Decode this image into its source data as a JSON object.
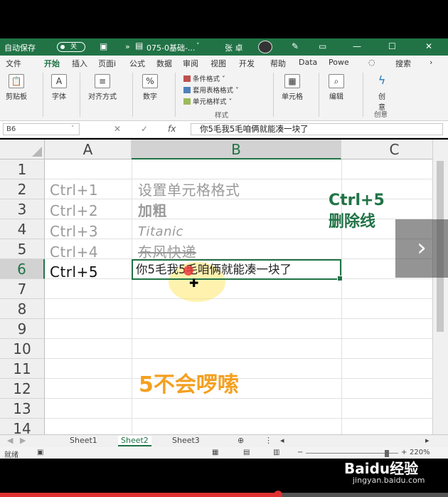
{
  "title_bar": {
    "autosave_label": "自动保存",
    "autosave_state": "关",
    "expand_glyph": "»",
    "file_name": "075-0基础-...",
    "user_name": "张 卓"
  },
  "tabs": [
    "文件",
    "开始",
    "插入",
    "页面⁠i",
    "公式",
    "数据",
    "审阅",
    "视图",
    "开发⁠",
    "帮助",
    "Data",
    "Powe"
  ],
  "active_tab": "开始",
  "search_label": "搜索",
  "ribbon": {
    "clipboard": "剪贴板",
    "font": "字体",
    "align": "对齐方式",
    "number": "数字",
    "cond_format": "条件格式 ˅",
    "table_format": "套用表格格式 ˅",
    "cell_style": "单元格样式 ˅",
    "styles_group": "样式",
    "cells": "单元格",
    "editing": "编辑",
    "create": "创",
    "create2": "意",
    "create_group": "创意"
  },
  "formula_bar": {
    "name_box": "B6",
    "fx": "fx",
    "content": "你5毛我5毛咱俩就能凑一块了"
  },
  "columns": [
    "A",
    "B",
    "C"
  ],
  "rows": [
    "1",
    "2",
    "3",
    "4",
    "5",
    "6",
    "7",
    "8",
    "9",
    "10",
    "11",
    "12",
    "13",
    "14"
  ],
  "cells": {
    "a2": "Ctrl+1",
    "b2": "设置单元格格式",
    "a3": "Ctrl+2",
    "b3": "加粗",
    "a4": "Ctrl+3",
    "b4": "Titanic",
    "a5": "Ctrl+4",
    "b5": "东风快递",
    "a6": "Ctrl+5",
    "b6": "你5毛我5毛咱俩就能凑一块了"
  },
  "annotation": {
    "line1": "Ctrl+5",
    "line2": "删除线",
    "caption": "5不会啰嗦"
  },
  "sheets": [
    "Sheet1",
    "Sheet2",
    "Sheet3"
  ],
  "active_sheet": "Sheet2",
  "status": {
    "ready": "就绪",
    "zoom": "220%"
  },
  "watermark": {
    "brand": "Bai⁠du经验",
    "url": "jingyan.baidu.com"
  },
  "video_progress": 0.62,
  "colors": {
    "excel_green": "#217346",
    "caption_orange": "#f4a020",
    "progress_red": "#e03030"
  }
}
